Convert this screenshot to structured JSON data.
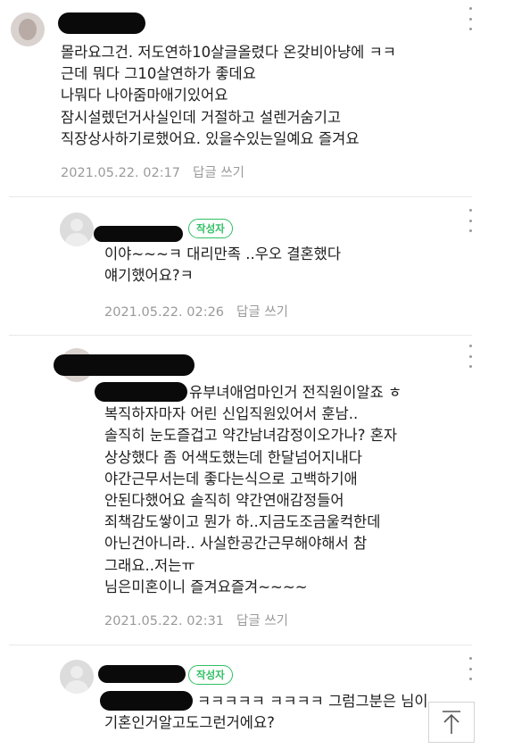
{
  "comments": [
    {
      "lines": [
        "몰라요그건. 저도연하10살글올렸다 온갖비아냥에 ㅋㅋ",
        "근데 뭐다 그10살연하가 좋데요",
        "나뭐다 나아줌마애기있어요",
        "잠시설렜던거사실인데 거절하고 설렌거숨기고",
        "직장상사하기로했어요. 있을수있는일예요 즐겨요"
      ],
      "date": "2021.05.22. 02:17",
      "reply": "답글 쓰기"
    },
    {
      "badge": "작성자",
      "lines": [
        "이야~~~ㅋ 대리만족 ..우오 결혼했다",
        "얘기했어요?ㅋ"
      ],
      "date": "2021.05.22. 02:26",
      "reply": "답글 쓰기"
    },
    {
      "lines": [
        "유부녀애엄마인거 전직원이알죠 ㅎ",
        "복직하자마자 어린 신입직원있어서 훈남..",
        "솔직히 눈도즐겁고 약간남녀감정이오가나? 혼자",
        "상상했다 좀 어색도했는데 한달넘어지내다",
        "야간근무서는데 좋다는식으로 고백하기애",
        "안된다했어요 솔직히 약간연애감정들어",
        "죄책감도쌓이고 뭔가 하..지금도조금울컥한데",
        "아닌건아니라.. 사실한공간근무해야해서 참",
        "그래요..저는ㅠ",
        "님은미혼이니 즐겨요즐겨~~~~"
      ],
      "date": "2021.05.22. 02:31",
      "reply": "답글 쓰기"
    },
    {
      "badge": "작성자",
      "lines": [
        "ㅋㅋㅋㅋㅋ ㅋㅋㅋㅋ 그럼그분은 님이",
        "기혼인거알고도그런거에요?"
      ]
    }
  ],
  "scroll_top_icon": "arrow-up-to-top-icon"
}
